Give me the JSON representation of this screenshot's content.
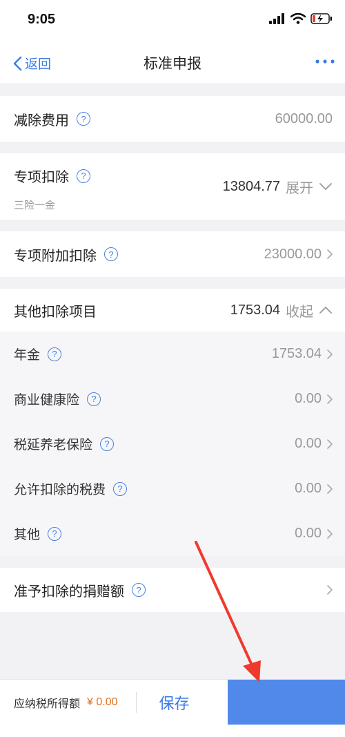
{
  "status": {
    "time": "9:05"
  },
  "nav": {
    "back_label": "返回",
    "title": "标准申报"
  },
  "rows": {
    "deduct_cost": {
      "label": "减除费用",
      "value": "60000.00"
    },
    "special": {
      "label": "专项扣除",
      "sub": "三险一金",
      "value": "13804.77",
      "toggle": "展开"
    },
    "special_additional": {
      "label": "专项附加扣除",
      "value": "23000.00"
    },
    "other": {
      "label": "其他扣除项目",
      "value": "1753.04",
      "toggle": "收起"
    },
    "donation": {
      "label": "准予扣除的捐赠额"
    }
  },
  "other_items": [
    {
      "label": "年金",
      "value": "1753.04"
    },
    {
      "label": "商业健康险",
      "value": "0.00"
    },
    {
      "label": "税延养老保险",
      "value": "0.00"
    },
    {
      "label": "允许扣除的税费",
      "value": "0.00"
    },
    {
      "label": "其他",
      "value": "0.00"
    }
  ],
  "bottom": {
    "taxable_label": "应纳税所得额",
    "taxable_value": "¥ 0.00",
    "save_label": "保存"
  },
  "colors": {
    "accent": "#3b7ae8",
    "submit": "#5189ea",
    "amount": "#e3731c",
    "annotation_arrow": "#f03a2e"
  },
  "icons": [
    "back-chevron-icon",
    "more-icon",
    "help-icon",
    "chevron-right-icon",
    "chevron-down-icon",
    "chevron-up-icon",
    "signal-icon",
    "wifi-icon",
    "battery-icon"
  ]
}
